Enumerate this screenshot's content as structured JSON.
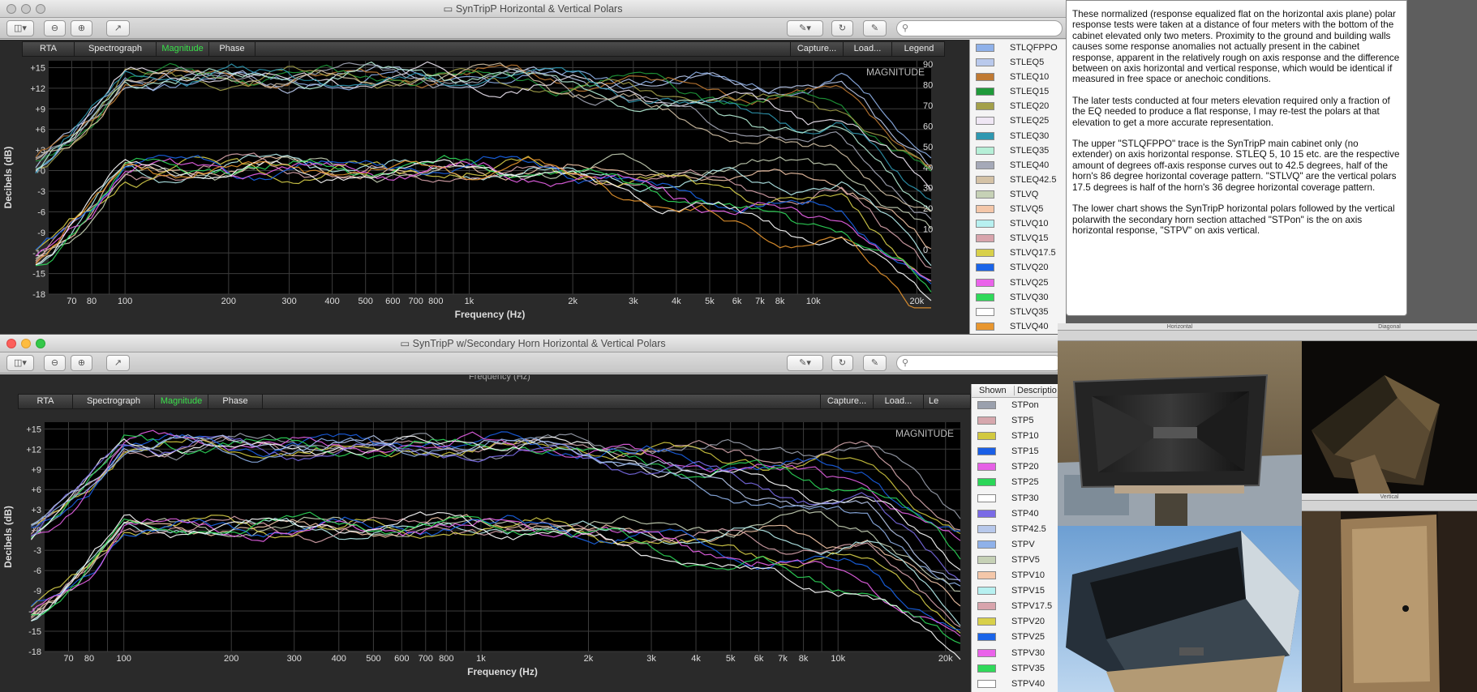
{
  "window1": {
    "title": "SynTripP Horizontal & Vertical Polars"
  },
  "window2": {
    "title": "SynTripP w/Secondary Horn Horizontal & Vertical Polars"
  },
  "tabs": {
    "rta": "RTA",
    "spectrograph": "Spectrograph",
    "magnitude": "Magnitude",
    "phase": "Phase",
    "capture": "Capture...",
    "load": "Load...",
    "legend": "Legend"
  },
  "tabs2_legend_partial": "Le",
  "colors": {
    "accent_tab": "#39e04a",
    "plot_bg": "#000000",
    "grid": "#3a3a3a"
  },
  "chart1": {
    "ylabel": "Decibels (dB)",
    "xlabel": "Frequency (Hz)",
    "magnitude_label": "MAGNITUDE",
    "y_ticks": [
      "+15",
      "+12",
      "+9",
      "+6",
      "+3",
      "+0",
      "-3",
      "-6",
      "-9",
      "-12",
      "-15",
      "-18"
    ],
    "right_ticks": [
      "90",
      "80",
      "70",
      "60",
      "50",
      "40",
      "30",
      "20",
      "10",
      "0"
    ],
    "x_ticks": [
      "70",
      "80",
      "100",
      "200",
      "300",
      "400",
      "500",
      "600",
      "700",
      "800",
      "1k",
      "2k",
      "3k",
      "4k",
      "5k",
      "6k",
      "7k",
      "8k",
      "10k",
      "20k"
    ]
  },
  "chart2": {
    "ylabel": "Decibels (dB)",
    "xlabel": "Frequency (Hz)",
    "magnitude_label": "MAGNITUDE",
    "top_label_partial": "Frequency (Hz)",
    "y_ticks": [
      "+15",
      "+12",
      "+9",
      "+6",
      "+3",
      "+0",
      "-3",
      "-6",
      "-9",
      "-12",
      "-15",
      "-18"
    ],
    "x_ticks": [
      "70",
      "80",
      "100",
      "200",
      "300",
      "400",
      "500",
      "600",
      "700",
      "800",
      "1k",
      "2k",
      "3k",
      "4k",
      "5k",
      "6k",
      "7k",
      "8k",
      "10k",
      "20k"
    ]
  },
  "legend1": [
    {
      "label": "STLQFPPO",
      "color": "#8fb1e9"
    },
    {
      "label": "STLEQ5",
      "color": "#b9c9ec"
    },
    {
      "label": "STLEQ10",
      "color": "#c07a33"
    },
    {
      "label": "STLEQ15",
      "color": "#1f9a3a"
    },
    {
      "label": "STLEQ20",
      "color": "#a3a04a"
    },
    {
      "label": "STLEQ25",
      "color": "#efe7f4"
    },
    {
      "label": "STLEQ30",
      "color": "#2f98b1"
    },
    {
      "label": "STLEQ35",
      "color": "#b6efd7"
    },
    {
      "label": "STLEQ40",
      "color": "#a5a9b8"
    },
    {
      "label": "STLEQ42.5",
      "color": "#d4c2a6"
    },
    {
      "label": "STLVQ",
      "color": "#c6d1b6"
    },
    {
      "label": "STLVQ5",
      "color": "#f4c7a9"
    },
    {
      "label": "STLVQ10",
      "color": "#b7f0f0"
    },
    {
      "label": "STLVQ15",
      "color": "#d8a4ac"
    },
    {
      "label": "STLVQ17.5",
      "color": "#d8d04a"
    },
    {
      "label": "STLVQ20",
      "color": "#1a64e8"
    },
    {
      "label": "STLVQ25",
      "color": "#ea63ea"
    },
    {
      "label": "STLVQ30",
      "color": "#2fd95a"
    },
    {
      "label": "STLVQ35",
      "color": "#ffffff"
    },
    {
      "label": "STLVQ40",
      "color": "#e8962f"
    }
  ],
  "legend2": {
    "col_shown": "Shown",
    "col_description": "Descriptio",
    "items": [
      {
        "label": "STPon",
        "color": "#9aa0ad"
      },
      {
        "label": "STP5",
        "color": "#d6a7ad"
      },
      {
        "label": "STP10",
        "color": "#d2c93f"
      },
      {
        "label": "STP15",
        "color": "#1a5fe6"
      },
      {
        "label": "STP20",
        "color": "#e660e6"
      },
      {
        "label": "STP25",
        "color": "#2bd658"
      },
      {
        "label": "STP30",
        "color": "#ffffff"
      },
      {
        "label": "STP40",
        "color": "#7a6be6"
      },
      {
        "label": "STP42.5",
        "color": "#b7c8eb"
      },
      {
        "label": "STPV",
        "color": "#8fb1e9"
      },
      {
        "label": "STPV5",
        "color": "#c6d1b6"
      },
      {
        "label": "STPV10",
        "color": "#f4c7a9"
      },
      {
        "label": "STPV15",
        "color": "#b7f0f0"
      },
      {
        "label": "STPV17.5",
        "color": "#d8a4ac"
      },
      {
        "label": "STPV20",
        "color": "#d8d04a"
      },
      {
        "label": "STPV25",
        "color": "#1a64e8"
      },
      {
        "label": "STPV30",
        "color": "#ea63ea"
      },
      {
        "label": "STPV35",
        "color": "#2fd95a"
      },
      {
        "label": "STPV40",
        "color": "#ffffff"
      }
    ]
  },
  "notes": {
    "p1": "These normalized (response equalized flat on the horizontal axis plane) polar response tests were taken at a distance of four meters with the bottom of the cabinet elevated only two meters. Proximity to the ground and building walls causes some response anomalies not actually present in the cabinet response, apparent in the relatively rough on axis response and the difference between on axis horizontal and vertical response, which would be identical if measured in free space or anechoic conditions.",
    "p2": "The later tests conducted at four meters elevation required only a fraction of the EQ needed to produce a flat response, I may re-test the polars at that elevation to get a more accurate representation.",
    "p3": "The upper  \"STLQFPPO\" trace is the SynTripP main cabinet only (no extender) on axis horizontal response. STLEQ 5, 10 15 etc. are the respective amount of degrees off-axis response curves out to 42.5 degrees, half of the horn's 86 degree horizontal coverage pattern.  \"STLVQ\" are the vertical polars 17.5 degrees is half of the horn's 36 degree horizontal coverage pattern.",
    "p4": "The lower chart shows the SynTripP horizontal polars followed by the vertical polarwith the secondary horn section attached \"STPon\" is the on axis horizontal response, \"STPV\" on axis vertical."
  },
  "photos": {
    "horizontal_title": "Horizontal",
    "diagonal_title": "Diagonal",
    "vertical_title": "Vertical"
  }
}
